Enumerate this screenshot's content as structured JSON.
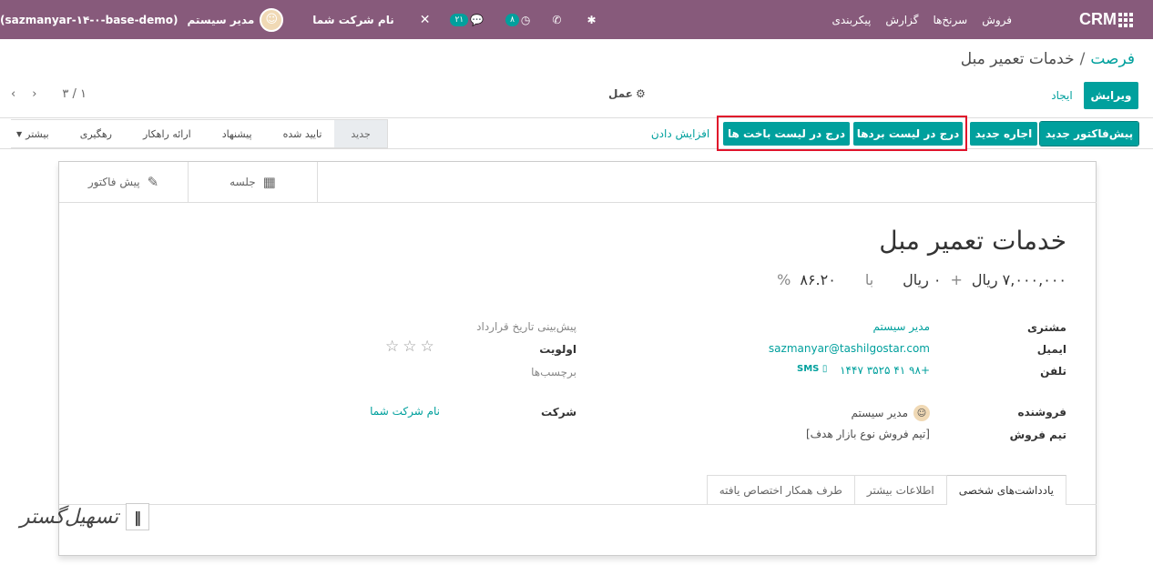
{
  "navbar": {
    "app_name": "CRM",
    "menu": [
      "فروش",
      "سرنخ‌ها",
      "گزارش",
      "پیکربندی"
    ],
    "activity_count": "۸",
    "messages_count": "۲۱",
    "company": "نام شرکت شما",
    "user": "مدیر سیستم",
    "database": "(sazmanyar-۱۴-۰-base-demo)"
  },
  "breadcrumb": {
    "parent": "فرصت",
    "separator": "/",
    "current": "خدمات تعمیر مبل"
  },
  "control": {
    "edit": "ویرایش",
    "create": "ایجاد",
    "action": "عمل",
    "pager": "۳ / ۱"
  },
  "header_buttons": {
    "new_quote": "پیش‌فاکتور جدید",
    "new_rental": "اجاره جدید",
    "mark_won": "درج در لیست بردها",
    "mark_lost": "درج در لیست باخت ها",
    "enrich": "افزایش دادن"
  },
  "stages": [
    "جدید",
    "تایید شده",
    "پیشنهاد",
    "ارائه راهکار",
    "رهگیری"
  ],
  "stages_more": "بیشتر",
  "smart_buttons": {
    "meeting": "جلسه",
    "quotation": "پیش فاکتور"
  },
  "lead": {
    "title": "خدمات تعمیر مبل",
    "revenue": "۷,۰۰۰,۰۰۰ ریال",
    "plus": "+",
    "recurring": "۰ ریال",
    "with": "با",
    "probability": "۸۶.۲۰",
    "percent": "%"
  },
  "fields": {
    "customer_label": "مشتری",
    "customer": "مدیر سیستم",
    "email_label": "ایمیل",
    "email": "sazmanyar@tashilgostar.com",
    "phone_label": "تلفن",
    "phone": "+۹۸ ۴۱ ۳۵۲۵ ۱۴۴۷",
    "sms": "SMS",
    "salesperson_label": "فروشنده",
    "salesperson": "مدیر سیستم",
    "team_label": "تیم فروش",
    "team": "[تیم فروش نوع بازار هدف]",
    "deadline_label": "پیش‌بینی تاریخ قرارداد",
    "priority_label": "اولویت",
    "tags_label": "برچسب‌ها",
    "company_label": "شرکت",
    "company": "نام شرکت شما"
  },
  "tabs": [
    "یادداشت‌های شخصی",
    "اطلاعات بیشتر",
    "طرف همکار اختصاص یافته"
  ],
  "colors": {
    "navbar": "#875a7b",
    "primary": "#00a09d",
    "highlight": "#e0142b"
  }
}
